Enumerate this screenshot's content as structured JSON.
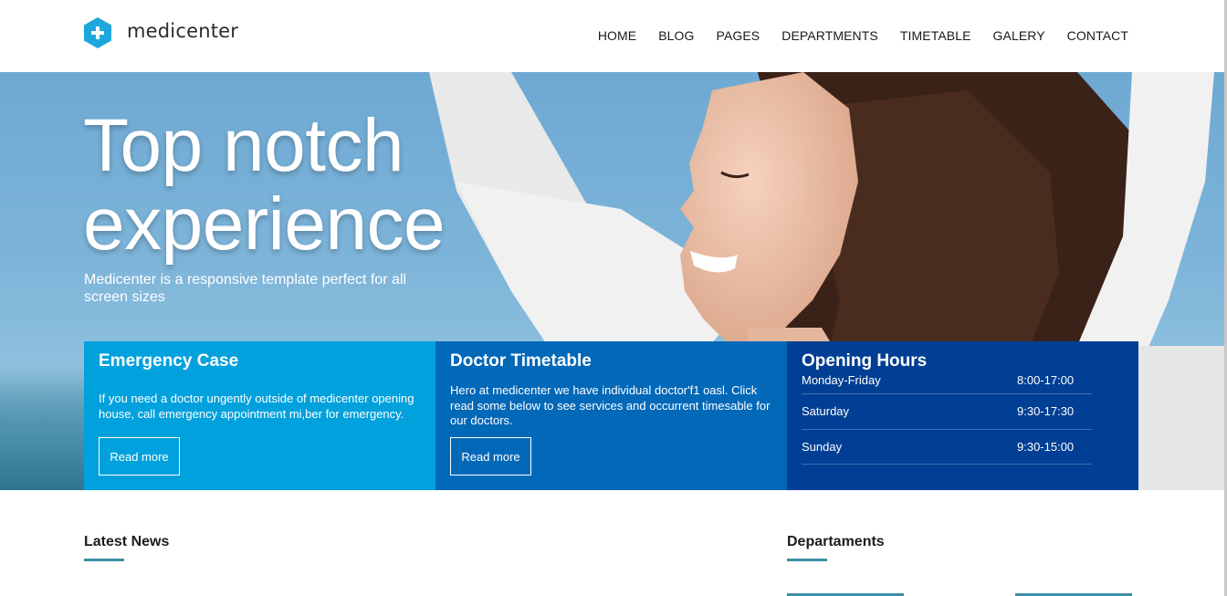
{
  "brand": {
    "name": "medicenter",
    "accent_color": "#1ea7dd"
  },
  "nav": {
    "items": [
      {
        "label": "HOME"
      },
      {
        "label": "BLOG"
      },
      {
        "label": "PAGES"
      },
      {
        "label": "DEPARTMENTS"
      },
      {
        "label": "TIMETABLE"
      },
      {
        "label": "GALERY"
      },
      {
        "label": "CONTACT"
      }
    ]
  },
  "hero": {
    "title_line1": "Top notch",
    "title_line2": "experience",
    "subtitle": "Medicenter is a responsive template perfect for all screen sizes"
  },
  "boxes": {
    "emergency": {
      "title": "Emergency Case",
      "text": "If you need a doctor ungently outside of medicenter opening house, call emergency appointment mi,ber for emergency.",
      "button": "Read more",
      "color": "#00a1dc"
    },
    "timetable": {
      "title": "Doctor Timetable",
      "text": "Hero at medicenter we have individual doctor'f1 oasl. Click read some below to see services and occurrent timesable for our doctors.",
      "button": "Read more",
      "color": "#0268b8"
    },
    "hours": {
      "title": "Opening Hours",
      "color": "#003f94",
      "rows": [
        {
          "day": "Monday-Friday",
          "time": "8:00-17:00"
        },
        {
          "day": "Saturday",
          "time": "9:30-17:30"
        },
        {
          "day": "Sunday",
          "time": "9:30-15:00"
        }
      ]
    }
  },
  "sections": {
    "latest_news": "Latest News",
    "departments": "Departaments"
  }
}
